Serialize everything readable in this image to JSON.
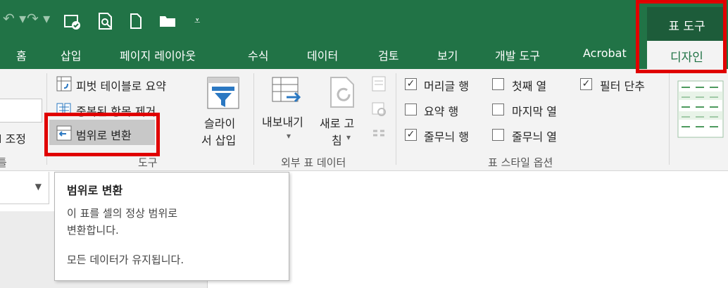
{
  "title_bar": {
    "table_tools_label": "표 도구"
  },
  "tabs": [
    {
      "label": "홈"
    },
    {
      "label": "삽입"
    },
    {
      "label": "페이지 레이아웃"
    },
    {
      "label": "수식"
    },
    {
      "label": "데이터"
    },
    {
      "label": "검토"
    },
    {
      "label": "보기"
    },
    {
      "label": "개발 도구"
    },
    {
      "label": "Acrobat"
    },
    {
      "label": "디자인"
    }
  ],
  "ribbon": {
    "left_partial": {
      "label": "l 조정",
      "group": "틀"
    },
    "tools": {
      "pivot_summary": "피벗 테이블로 요약",
      "remove_duplicates": "중복된 항목 제거",
      "convert_to_range": "범위로 변환",
      "slicer_line1": "슬라이",
      "slicer_line2": "서 삽입",
      "group_label": "도구"
    },
    "external": {
      "export_label": "내보내기",
      "refresh_line1": "새로 고",
      "refresh_line2": "침",
      "dropdown": "▾",
      "group_label": "외부 표 데이터"
    },
    "style_options": {
      "header_row": "머리글 행",
      "total_row": "요약 행",
      "banded_rows": "줄무늬 행",
      "first_column": "첫째 열",
      "last_column": "마지막 열",
      "banded_columns": "줄무늬 열",
      "filter_button": "필터 단추",
      "group_label": "표 스타일 옵션",
      "checked": {
        "header_row": true,
        "total_row": false,
        "banded_rows": true,
        "first_column": false,
        "last_column": false,
        "banded_columns": false,
        "filter_button": true
      }
    }
  },
  "tooltip": {
    "title": "범위로 변환",
    "line1": "이 표를 셀의 정상 범위로",
    "line2": "변환합니다.",
    "line3": "모든 데이터가 유지됩니다."
  },
  "colors": {
    "accent": "#217346",
    "highlight": "#e00000"
  }
}
